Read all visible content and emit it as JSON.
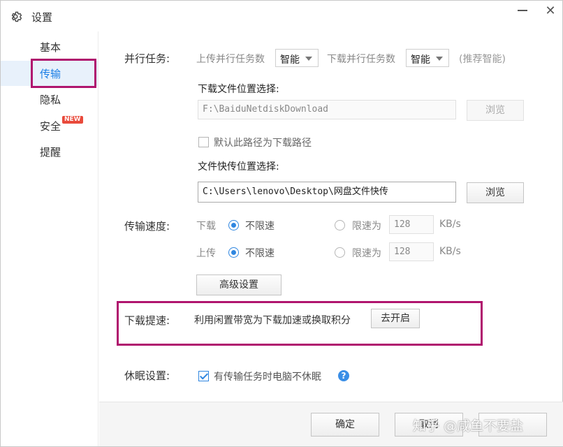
{
  "window": {
    "title": "设置"
  },
  "sidebar": {
    "items": [
      {
        "label": "基本"
      },
      {
        "label": "传输"
      },
      {
        "label": "隐私"
      },
      {
        "label": "安全",
        "badge": "NEW"
      },
      {
        "label": "提醒"
      }
    ]
  },
  "parallel": {
    "label": "并行任务:",
    "upload_label": "上传并行任务数",
    "upload_value": "智能",
    "download_label": "下载并行任务数",
    "download_value": "智能",
    "hint": "(推荐智能)"
  },
  "download_location": {
    "label": "下载文件位置选择:",
    "path": "F:\\BaiduNetdiskDownload",
    "browse": "浏览",
    "default_checkbox": "默认此路径为下载路径",
    "default_checked": false
  },
  "quick_location": {
    "label": "文件快传位置选择:",
    "path": "C:\\Users\\lenovo\\Desktop\\网盘文件快传",
    "browse": "浏览"
  },
  "speed": {
    "label": "传输速度:",
    "download": {
      "label": "下载",
      "unlimited": "不限速",
      "limit": "限速为",
      "value": "128",
      "unit": "KB/s"
    },
    "upload": {
      "label": "上传",
      "unlimited": "不限速",
      "limit": "限速为",
      "value": "128",
      "unit": "KB/s"
    },
    "advanced": "高级设置"
  },
  "boost": {
    "label": "下载提速:",
    "text": "利用闲置带宽为下载加速或换取积分",
    "button": "去开启"
  },
  "sleep": {
    "label": "休眠设置:",
    "checkbox": "有传输任务时电脑不休眠",
    "checked": true,
    "help": "?"
  },
  "footer": {
    "ok": "确定",
    "cancel": "取消"
  },
  "watermark": "知乎 @咸鱼不要盐",
  "colors": {
    "accent": "#1a7ee6",
    "highlight": "#b0156e",
    "badge": "#e94a3b"
  }
}
